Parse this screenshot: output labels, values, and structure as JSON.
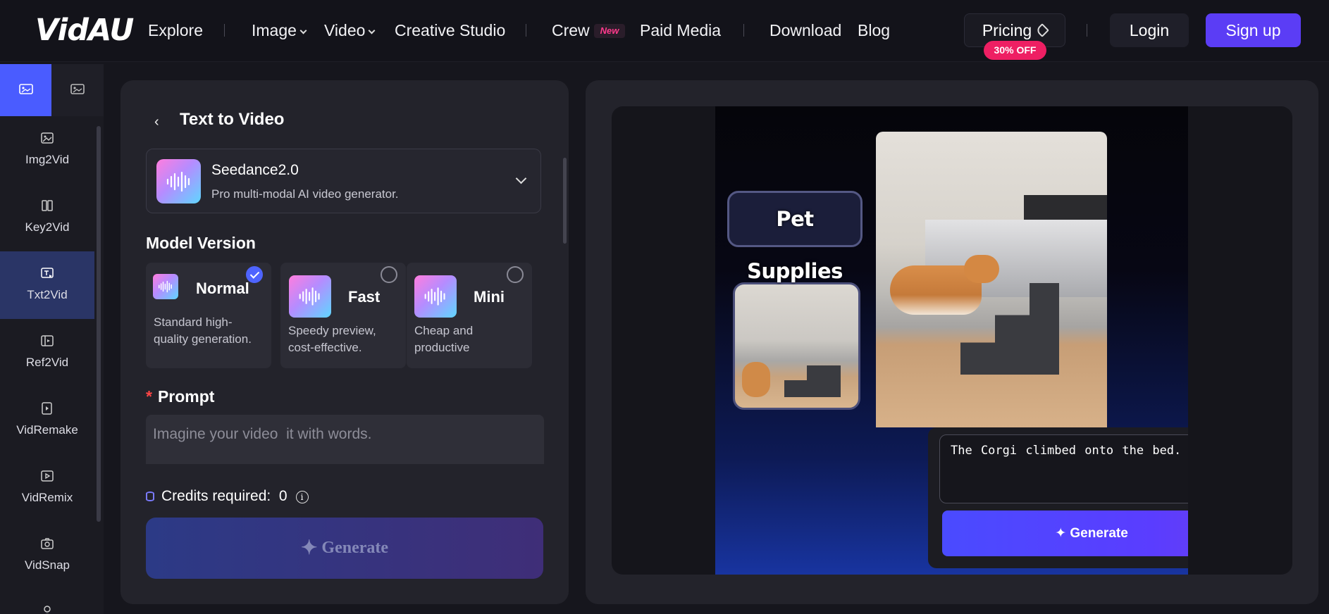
{
  "brand": {
    "logo": "VidAU"
  },
  "nav": {
    "explore": "Explore",
    "image": "Image",
    "video": "Video",
    "creative_studio": "Creative Studio",
    "crew": "Crew",
    "crew_badge": "New",
    "paid_media": "Paid Media",
    "download": "Download",
    "blog": "Blog",
    "pricing": "Pricing",
    "pricing_badge": "30% OFF",
    "login": "Login",
    "signup": "Sign up"
  },
  "sidebar": {
    "items": [
      {
        "label": "Img2Vid",
        "icon": "image-icon",
        "active": false
      },
      {
        "label": "Key2Vid",
        "icon": "keyframe-icon",
        "active": false
      },
      {
        "label": "Txt2Vid",
        "icon": "text-video-icon",
        "active": true
      },
      {
        "label": "Ref2Vid",
        "icon": "reference-icon",
        "active": false
      },
      {
        "label": "VidRemake",
        "icon": "remake-icon",
        "active": false
      },
      {
        "label": "VidRemix",
        "icon": "remix-icon",
        "active": false
      },
      {
        "label": "VidSnap",
        "icon": "snap-icon",
        "active": false
      }
    ]
  },
  "panel": {
    "back_icon": "‹",
    "title": "Text to Video",
    "model": {
      "name": "Seedance2.0",
      "description": "Pro multi-modal AI video generator."
    },
    "model_version_label": "Model Version",
    "versions": [
      {
        "name": "Normal",
        "description": "Standard high-quality generation.",
        "selected": true
      },
      {
        "name": "Fast",
        "description": "Speedy preview, cost-effective.",
        "selected": false
      },
      {
        "name": "Mini",
        "description": "Cheap and productive",
        "selected": false
      }
    ],
    "prompt_label": "Prompt",
    "prompt_required_mark": "*",
    "prompt_placeholder": "Imagine your video  it with words.",
    "credits_label": "Credits required:",
    "credits_value": "0",
    "generate_label": "Generate"
  },
  "preview": {
    "pill_text": "Pet Supplies",
    "prompt_text": "The Corgi climbed onto the bed.",
    "generate_label": "Generate"
  },
  "colors": {
    "accent": "#5b3df5",
    "sidebar_active": "#2a3566",
    "badge_pink": "#ee1f63"
  }
}
